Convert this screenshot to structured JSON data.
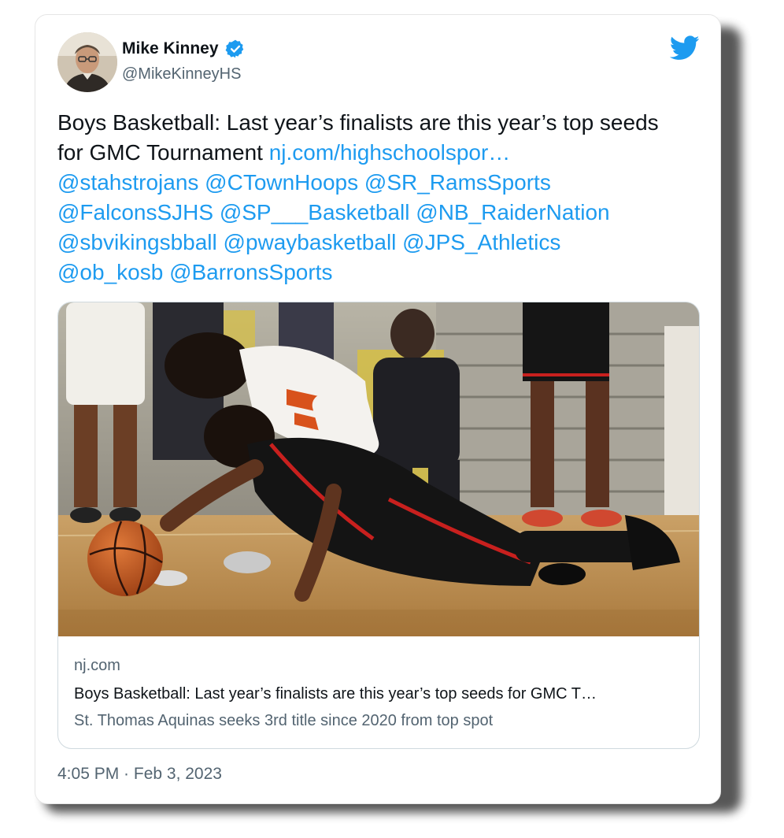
{
  "author": {
    "name": "Mike Kinney",
    "handle": "@MikeKinneyHS",
    "verified": true,
    "avatar_icon": "person-avatar"
  },
  "tweet": {
    "text_plain": "Boys Basketball: Last year’s finalists are this year’s top seeds for GMC Tournament ",
    "link": "nj.com/highschoolspor…",
    "mentions_line1": "@stahstrojans @CTownHoops @SR_RamsSports",
    "mentions_line2": "@FalconsSJHS @SP___Basketball @NB_RaiderNation",
    "mentions_line3": "@sbvikingsbball @pwaybasketball @JPS_Athletics",
    "mentions_line4": "@ob_kosb @BarronsSports"
  },
  "link_card": {
    "domain": "nj.com",
    "title": "Boys Basketball: Last year’s finalists are this year’s top seeds for GMC T…",
    "description": "St. Thomas Aquinas seeks 3rd title since 2020 from top spot"
  },
  "timestamp": "4:05 PM · Feb 3, 2023",
  "colors": {
    "link": "#1d9bf0",
    "text": "#0f1419",
    "secondary": "#536471",
    "verified": "#1d9bf0",
    "floor": "#b98a4a"
  }
}
